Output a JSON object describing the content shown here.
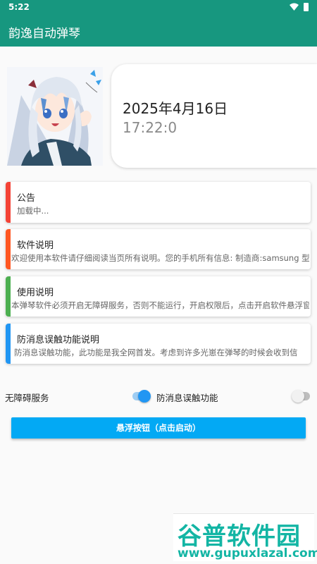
{
  "status_bar": {
    "time": "5:22"
  },
  "app_bar": {
    "title": "韵逸自动弹琴"
  },
  "date_card": {
    "date": "2025年4月16日",
    "clock": "17:22:0"
  },
  "cards": [
    {
      "title": "公告",
      "body": "加载中...",
      "color": "#f44336"
    },
    {
      "title": "软件说明",
      "body": "欢迎使用本软件请仔细阅读当页所有说明。您的手机所有信息: 制造商:samsung 型号",
      "color": "#ff5722"
    },
    {
      "title": "使用说明",
      "body": "本弹琴软件必须开启无障碍服务，否则不能运行，开启权限后，点击开启软件悬浮窗",
      "color": "#4caf50"
    },
    {
      "title": "防消息误触功能说明",
      "body": "防消息误触功能，此功能是我全网首发。考虑到许多光崽在弹琴的时候会收到信",
      "color": "#2196f3"
    }
  ],
  "switches": {
    "accessibility": {
      "label": "无障碍服务",
      "on": true
    },
    "anti_touch": {
      "label": "防消息误触功能",
      "on": false
    }
  },
  "float_button": {
    "label": "悬浮按钮（点击启动）"
  },
  "watermark": {
    "main": "谷普软件园",
    "url": "www.gupuxlazal.com"
  },
  "colors": {
    "primary": "#17977f",
    "accent": "#03a9f4",
    "switch_on": "#2196f3"
  }
}
